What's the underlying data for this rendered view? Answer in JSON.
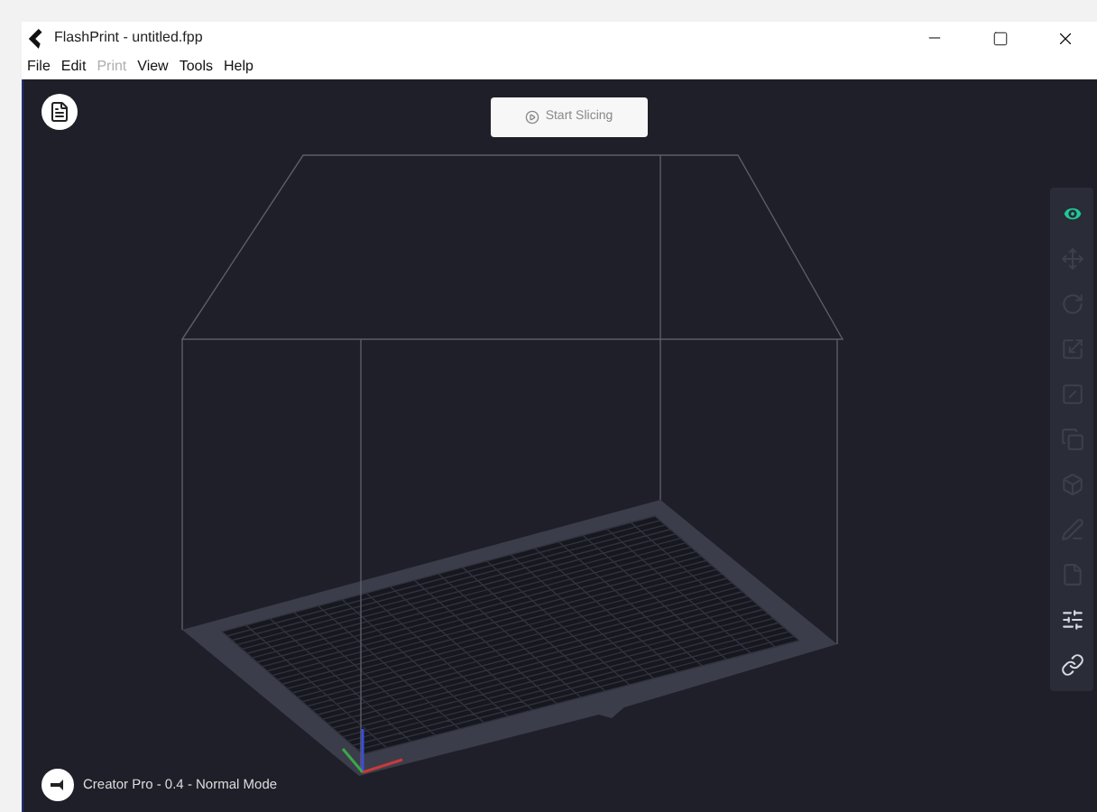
{
  "window": {
    "title": "FlashPrint - untitled.fpp"
  },
  "menu": [
    {
      "label": "File",
      "disabled": false
    },
    {
      "label": "Edit",
      "disabled": false
    },
    {
      "label": "Print",
      "disabled": true
    },
    {
      "label": "View",
      "disabled": false
    },
    {
      "label": "Tools",
      "disabled": false
    },
    {
      "label": "Help",
      "disabled": false
    }
  ],
  "start_button": {
    "label": "Start Slicing",
    "disabled": true
  },
  "tools": [
    {
      "kind": "eye",
      "selected": true,
      "disabled": false
    },
    {
      "kind": "move",
      "selected": false,
      "disabled": true
    },
    {
      "kind": "rotate",
      "selected": false,
      "disabled": true
    },
    {
      "kind": "scale",
      "selected": false,
      "disabled": true
    },
    {
      "kind": "cut",
      "selected": false,
      "disabled": true
    },
    {
      "kind": "layout",
      "selected": false,
      "disabled": true
    },
    {
      "kind": "support",
      "selected": false,
      "disabled": true
    },
    {
      "kind": "pen",
      "selected": false,
      "disabled": true
    },
    {
      "kind": "page",
      "selected": false,
      "disabled": true
    },
    {
      "kind": "sliders",
      "selected": false,
      "disabled": false
    },
    {
      "kind": "link",
      "selected": false,
      "disabled": false
    }
  ],
  "status": {
    "printer": "Creator Pro - 0.4 - Normal Mode"
  }
}
